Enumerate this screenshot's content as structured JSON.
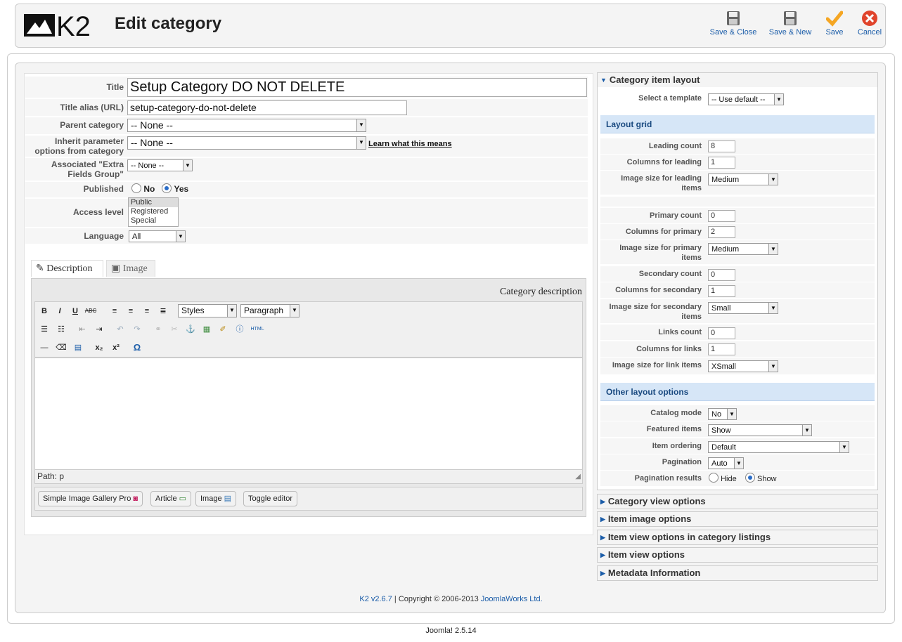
{
  "header": {
    "logo_text": "K2",
    "title": "Edit category",
    "buttons": {
      "save_close": "Save & Close",
      "save_new": "Save & New",
      "save": "Save",
      "cancel": "Cancel"
    }
  },
  "form": {
    "title_label": "Title",
    "title_value": "Setup Category DO NOT DELETE",
    "alias_label": "Title alias (URL)",
    "alias_value": "setup-category-do-not-delete",
    "parent_label": "Parent category",
    "parent_value": "-- None --",
    "inherit_label_1": "Inherit parameter",
    "inherit_label_2": "options from category",
    "inherit_value": "-- None --",
    "inherit_link": "Learn what this means",
    "extra_label_1": "Associated \"Extra",
    "extra_label_2": "Fields Group\"",
    "extra_value": "-- None --",
    "published_label": "Published",
    "published_no": "No",
    "published_yes": "Yes",
    "access_label": "Access level",
    "access_options": [
      "Public",
      "Registered",
      "Special"
    ],
    "language_label": "Language",
    "language_value": "All"
  },
  "editor": {
    "tab_description": "Description",
    "tab_image": "Image",
    "caption": "Category description",
    "styles": "Styles",
    "paragraph": "Paragraph",
    "html_btn": "HTML",
    "path": "Path: p",
    "buttons": {
      "sigpro": "Simple Image Gallery Pro",
      "article": "Article",
      "image": "Image",
      "toggle": "Toggle editor"
    }
  },
  "right": {
    "item_layout_header": "Category item layout",
    "template_label": "Select a template",
    "template_value": "-- Use default --",
    "layout_grid": "Layout grid",
    "leading_count_label": "Leading count",
    "leading_count": "8",
    "columns_leading_label": "Columns for leading",
    "columns_leading": "1",
    "img_leading_label_1": "Image size for leading",
    "img_leading_label_2": "items",
    "img_leading": "Medium",
    "primary_count_label": "Primary count",
    "primary_count": "0",
    "columns_primary_label": "Columns for primary",
    "columns_primary": "2",
    "img_primary_label_1": "Image size for primary",
    "img_primary_label_2": "items",
    "img_primary": "Medium",
    "secondary_count_label": "Secondary count",
    "secondary_count": "0",
    "columns_secondary_label": "Columns for secondary",
    "columns_secondary": "1",
    "img_secondary_label_1": "Image size for secondary",
    "img_secondary_label_2": "items",
    "img_secondary": "Small",
    "links_count_label": "Links count",
    "links_count": "0",
    "columns_links_label": "Columns for links",
    "columns_links": "1",
    "img_links_label": "Image size for link items",
    "img_links": "XSmall",
    "other_layout": "Other layout options",
    "catalog_label": "Catalog mode",
    "catalog": "No",
    "featured_label": "Featured items",
    "featured": "Show",
    "ordering_label": "Item ordering",
    "ordering": "Default",
    "pagination_label": "Pagination",
    "pagination": "Auto",
    "pag_results_label": "Pagination results",
    "pag_hide": "Hide",
    "pag_show": "Show",
    "collapsed": [
      "Category view options",
      "Item image options",
      "Item view options in category listings",
      "Item view options",
      "Metadata Information"
    ]
  },
  "footer": {
    "version_link": "K2 v2.6.7",
    "copyright": " | Copyright © 2006-2013 ",
    "company_link": "JoomlaWorks Ltd.",
    "joomla": "Joomla! 2.5.14"
  },
  "colors": {
    "link": "#1a5ca8",
    "subhead_bg": "#d6e6f7",
    "save_check": "#f5a623",
    "cancel_red": "#e0442c"
  }
}
